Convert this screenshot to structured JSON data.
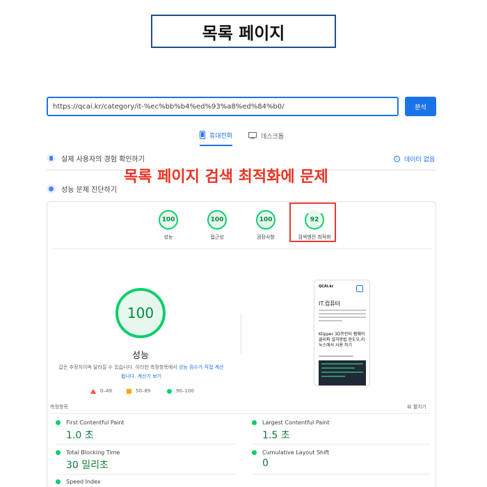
{
  "page_title": "목록 페이지",
  "search": {
    "url": "https://qcai.kr/category/it-%ec%bb%b4%ed%93%a8%ed%84%b0/",
    "analyze_label": "분석"
  },
  "tabs": [
    {
      "label": "휴대전화",
      "active": true
    },
    {
      "label": "데스크톱",
      "active": false
    }
  ],
  "crux": {
    "label": "실제 사용자의 경험 확인하기",
    "no_data": "데이터 없음"
  },
  "annotation": "목록 페이지 검색 최적화에 문제",
  "diagnose": {
    "label": "성능 문제 진단하기"
  },
  "categories": [
    {
      "score": "100",
      "label": "성능"
    },
    {
      "score": "100",
      "label": "접근성"
    },
    {
      "score": "100",
      "label": "권장사항"
    },
    {
      "score": "92",
      "label": "검색엔진 최적화"
    }
  ],
  "performance": {
    "score": "100",
    "title": "성능",
    "desc_text": "값은 추정치이며 달라질 수 있습니다. 이러한 측정항목에서 ",
    "desc_link": "성능 점수가 직접 계산됩니다.",
    "desc_link2": "계산기 보기"
  },
  "legend": [
    {
      "label": "0–49",
      "color": "#ff4e42"
    },
    {
      "label": "50–89",
      "color": "#ffa400"
    },
    {
      "label": "90–100",
      "color": "#0cce6b"
    }
  ],
  "thumbnail": {
    "site": "QCAI.kr",
    "heading": "IT.컴퓨터",
    "post": "Klipper 3D프린터 펌웨어 클리퍼 설치방법 윈도우,리눅스에서 사용 하기"
  },
  "metrics": {
    "header": "측정항목",
    "expand": "뷰 펼치기",
    "items": [
      {
        "label": "First Contentful Paint",
        "value": "1.0 초"
      },
      {
        "label": "Largest Contentful Paint",
        "value": "1.5 초"
      },
      {
        "label": "Total Blocking Time",
        "value": "30 밀리초"
      },
      {
        "label": "Cumulative Layout Shift",
        "value": "0"
      },
      {
        "label": "Speed Index",
        "value": ""
      }
    ]
  },
  "colors": {
    "good": "#0cce6b",
    "accent": "#1a73e8",
    "alert": "#ea3323"
  }
}
